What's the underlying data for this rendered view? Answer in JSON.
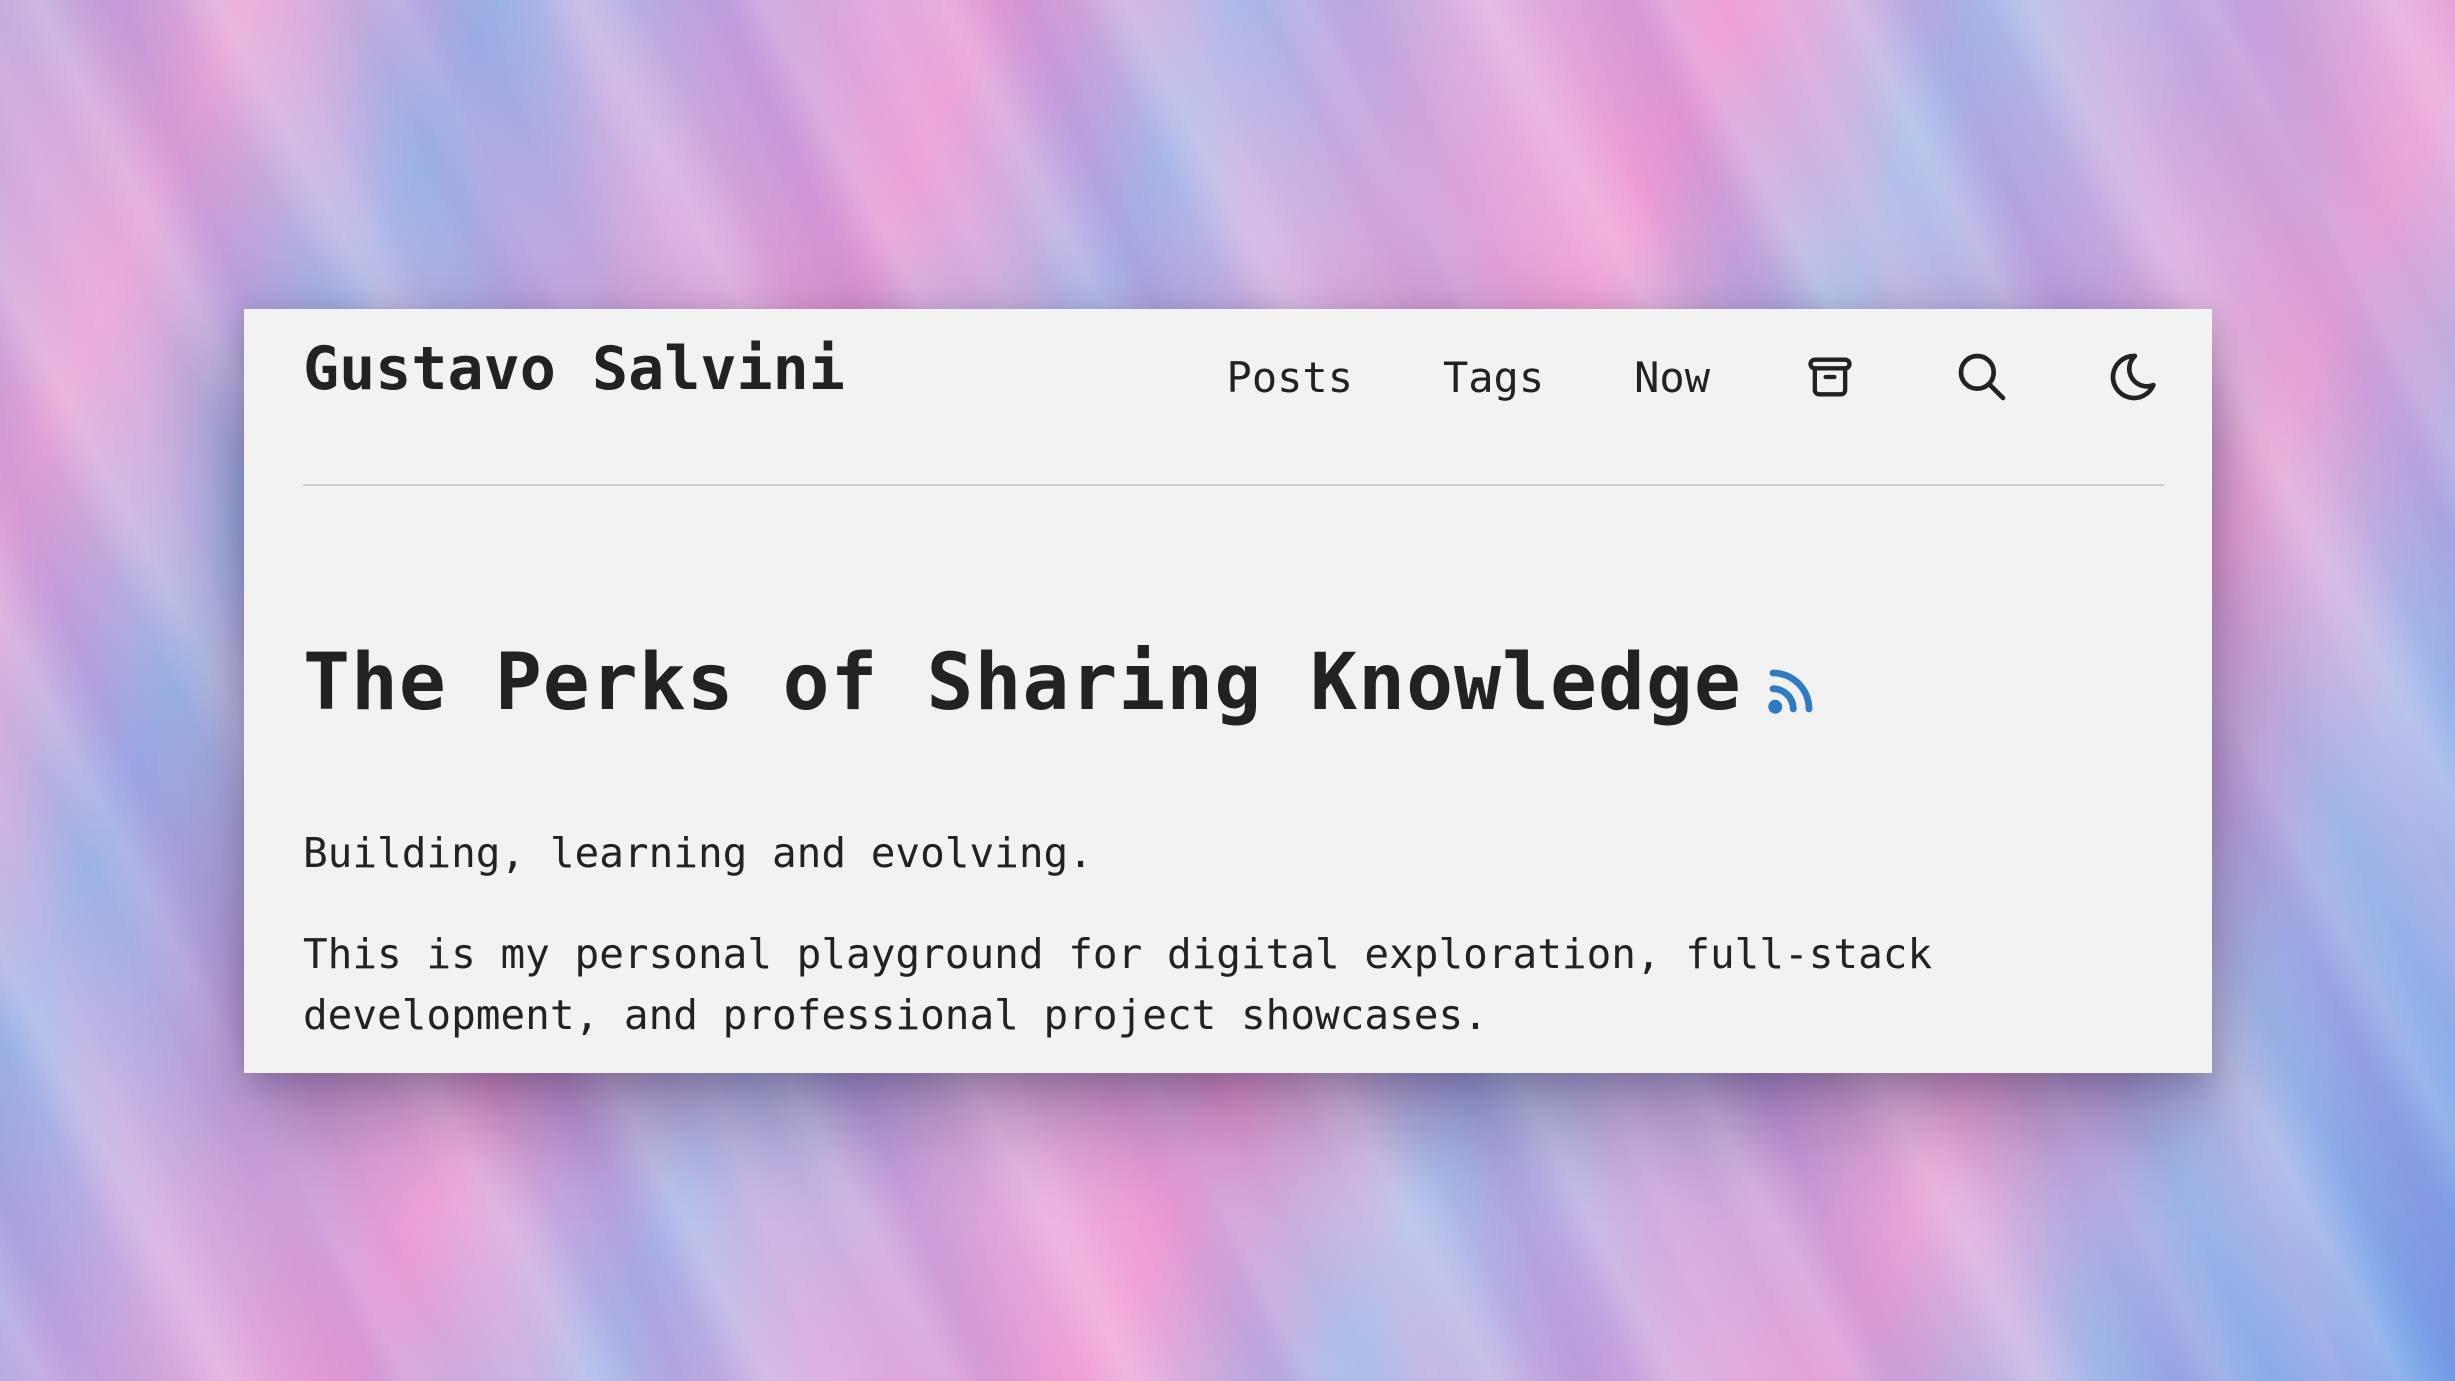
{
  "site": {
    "title": "Gustavo Salvini"
  },
  "nav": {
    "items": [
      {
        "label": "Posts"
      },
      {
        "label": "Tags"
      },
      {
        "label": "Now"
      }
    ],
    "icons": [
      "archive-icon",
      "search-icon",
      "moon-icon"
    ]
  },
  "post": {
    "title": "The Perks of Sharing Knowledge",
    "rss_icon": "rss-icon",
    "paragraphs": [
      "Building, learning and evolving.",
      "This is my personal playground for digital exploration, full-stack development, and professional project showcases."
    ]
  },
  "colors": {
    "card_background": "#f2f2f2",
    "text": "#222222",
    "accent_rss": "#2f7ac4",
    "divider": "#cfcfcf"
  }
}
